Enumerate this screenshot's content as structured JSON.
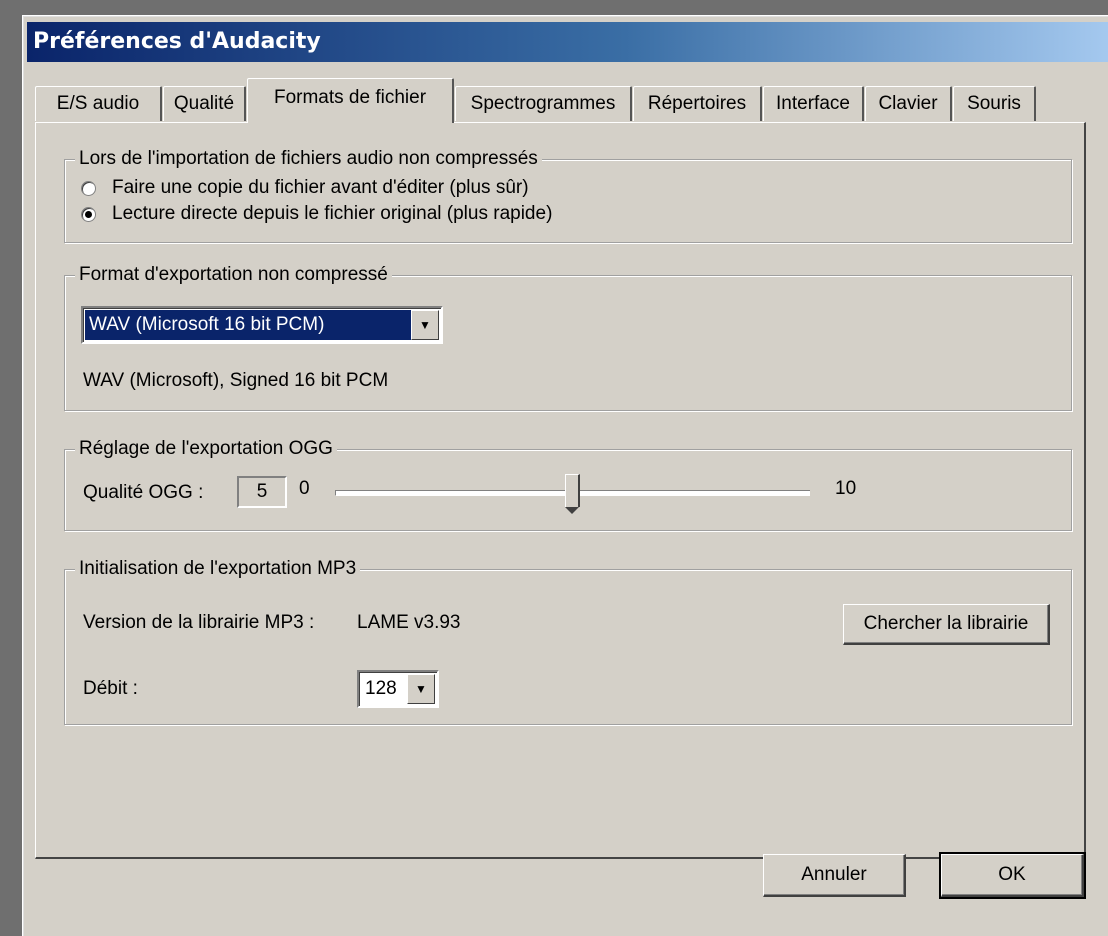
{
  "window": {
    "title": "Préférences d'Audacity"
  },
  "tabs": [
    {
      "label": "E/S audio"
    },
    {
      "label": "Qualité"
    },
    {
      "label": "Formats de fichier"
    },
    {
      "label": "Spectrogrammes"
    },
    {
      "label": "Répertoires"
    },
    {
      "label": "Interface"
    },
    {
      "label": "Clavier"
    },
    {
      "label": "Souris"
    }
  ],
  "active_tab": "Formats de fichier",
  "import_group": {
    "title": "Lors de l'importation de fichiers audio non compressés",
    "options": [
      {
        "label": "Faire une copie du fichier avant d'éditer (plus sûr)",
        "selected": false
      },
      {
        "label": "Lecture directe depuis le fichier original (plus rapide)",
        "selected": true
      }
    ]
  },
  "export_group": {
    "title": "Format d'exportation non compressé",
    "format_value": "WAV (Microsoft 16 bit PCM)",
    "format_description": "WAV (Microsoft), Signed 16 bit PCM"
  },
  "ogg_group": {
    "title": "Réglage de l'exportation OGG",
    "quality_label": "Qualité OGG :",
    "quality_value": "5",
    "slider_min": "0",
    "slider_max": "10",
    "slider_fraction": 0.5
  },
  "mp3_group": {
    "title": "Initialisation de l'exportation MP3",
    "version_label": "Version de la librairie MP3 :",
    "version_value": "LAME v3.93",
    "find_button": "Chercher la librairie",
    "bitrate_label": "Débit :",
    "bitrate_value": "128"
  },
  "dialog_buttons": {
    "cancel": "Annuler",
    "ok": "OK"
  },
  "icons": {
    "dropdown": "chevron-down-icon"
  }
}
